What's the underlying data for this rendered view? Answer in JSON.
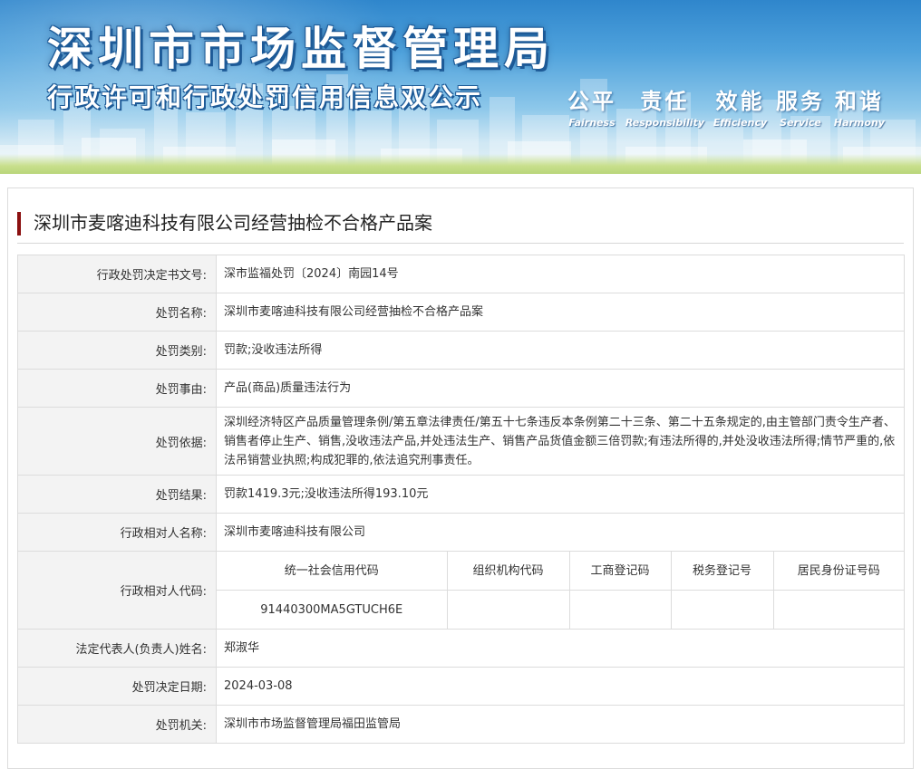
{
  "banner": {
    "title": "深圳市市场监督管理局",
    "subtitle": "行政许可和行政处罚信用信息双公示",
    "slogans": [
      {
        "cn": "公平",
        "en": "Fairness"
      },
      {
        "cn": "责任",
        "en": "Responsibility"
      },
      {
        "cn": "效能",
        "en": "Efficiency"
      },
      {
        "cn": "服务",
        "en": "Service"
      },
      {
        "cn": "和谐",
        "en": "Harmony"
      }
    ]
  },
  "page": {
    "title": "深圳市麦喀迪科技有限公司经营抽检不合格产品案"
  },
  "details": {
    "decision_no": {
      "label": "行政处罚决定书文号:",
      "value": "深市监福处罚〔2024〕南园14号"
    },
    "case_name": {
      "label": "处罚名称:",
      "value": "深圳市麦喀迪科技有限公司经营抽检不合格产品案"
    },
    "category": {
      "label": "处罚类别:",
      "value": "罚款;没收违法所得"
    },
    "reason": {
      "label": "处罚事由:",
      "value": "产品(商品)质量违法行为"
    },
    "basis": {
      "label": "处罚依据:",
      "value": "深圳经济特区产品质量管理条例/第五章法律责任/第五十七条违反本条例第二十三条、第二十五条规定的,由主管部门责令生产者、销售者停止生产、销售,没收违法产品,并处违法生产、销售产品货值金额三倍罚款;有违法所得的,并处没收违法所得;情节严重的,依法吊销营业执照;构成犯罪的,依法追究刑事责任。"
    },
    "result": {
      "label": "处罚结果:",
      "value": "罚款1419.3元;没收违法所得193.10元"
    },
    "party_name": {
      "label": "行政相对人名称:",
      "value": "深圳市麦喀迪科技有限公司"
    },
    "party_code": {
      "label": "行政相对人代码:",
      "headers": [
        "统一社会信用代码",
        "组织机构代码",
        "工商登记码",
        "税务登记号",
        "居民身份证号码"
      ],
      "values": [
        "91440300MA5GTUCH6E",
        "",
        "",
        "",
        ""
      ]
    },
    "legal_rep": {
      "label": "法定代表人(负责人)姓名:",
      "value": "郑淑华"
    },
    "decision_date": {
      "label": "处罚决定日期:",
      "value": "2024-03-08"
    },
    "authority": {
      "label": "处罚机关:",
      "value": "深圳市市场监督管理局福田监管局"
    }
  },
  "colors": {
    "accent_bar": "#8b1010",
    "banner_blue": "#2f86cc",
    "label_bg": "#f3f3f3",
    "border": "#dcdcdc"
  }
}
